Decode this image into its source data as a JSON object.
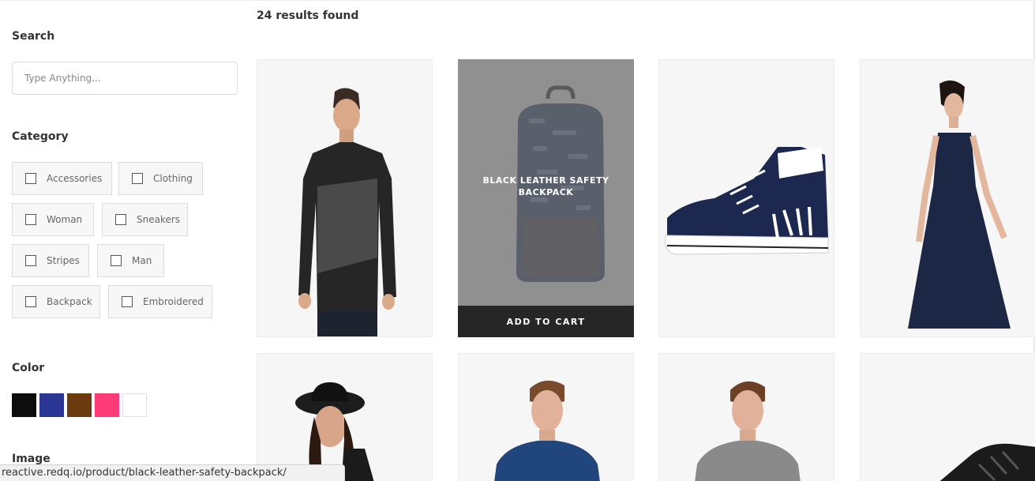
{
  "sidebar": {
    "search_title": "Search",
    "search_placeholder": "Type Anything...",
    "category_title": "Category",
    "categories": [
      "Accessories",
      "Clothing",
      "Woman",
      "Sneakers",
      "Stripes",
      "Man",
      "Backpack",
      "Embroidered"
    ],
    "color_title": "Color",
    "colors": [
      "#0d0d0d",
      "#2b3593",
      "#6b3b0f",
      "#fd3b78",
      "#ffffff"
    ],
    "image_title": "Image"
  },
  "main": {
    "results_text": "24 results found",
    "hover_product_title": "BLACK LEATHER SAFETY BACKPACK",
    "add_to_cart": "ADD TO CART"
  },
  "status_url": "reactive.redq.io/product/black-leather-safety-backpack/"
}
